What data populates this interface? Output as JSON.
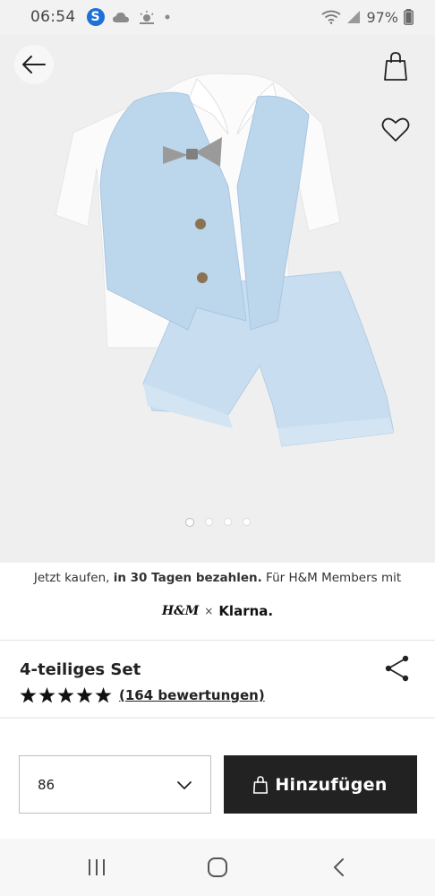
{
  "status_bar": {
    "time": "06:54",
    "battery": "97%",
    "badge_letter": "S"
  },
  "product": {
    "title": "4-teiliges Set",
    "rating_stars": 5,
    "reviews": "(164 bewertungen)",
    "image_count": 4,
    "active_image": 0,
    "colors": {
      "vest": "#bcd6ec",
      "shirt": "#fafafa",
      "bowtie": "#9a9a9a",
      "buttons": "#8a7350"
    }
  },
  "klarna": {
    "text_pre": "Jetzt kaufen, ",
    "text_bold": "in 30 Tagen bezahlen.",
    "text_post": " Für H&M Members mit",
    "hm_logo": "H&M",
    "separator": "×",
    "klarna_logo": "Klarna."
  },
  "purchase": {
    "size_value": "86",
    "add_label": "Hinzufügen"
  },
  "icons": {
    "back": "arrow-left-icon",
    "bag": "shopping-bag-icon",
    "favorite": "heart-icon",
    "share": "share-icon",
    "chevron": "chevron-down-icon"
  },
  "accent_color": "#222222"
}
